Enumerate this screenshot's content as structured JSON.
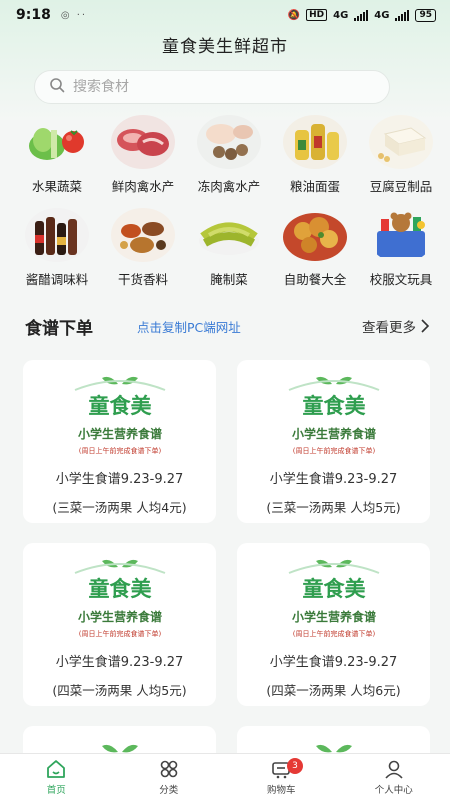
{
  "status_bar": {
    "time": "9:18",
    "left_icons": "◎ ··",
    "hd_label": "HD",
    "net1": "4G",
    "net2": "4G",
    "battery": "95"
  },
  "header": {
    "title": "童食美生鲜超市"
  },
  "search": {
    "placeholder": "搜索食材"
  },
  "categories": [
    {
      "label": "水果蔬菜",
      "icon": "vegetables-image"
    },
    {
      "label": "鲜肉禽水产",
      "icon": "meat-image"
    },
    {
      "label": "冻肉禽水产",
      "icon": "frozen-meat-image"
    },
    {
      "label": "粮油面蛋",
      "icon": "grain-oil-image"
    },
    {
      "label": "豆腐豆制品",
      "icon": "tofu-image"
    },
    {
      "label": "酱醋调味料",
      "icon": "sauce-image"
    },
    {
      "label": "干货香料",
      "icon": "spice-image"
    },
    {
      "label": "腌制菜",
      "icon": "pickle-image"
    },
    {
      "label": "自助餐大全",
      "icon": "buffet-image"
    },
    {
      "label": "校服文玩具",
      "icon": "toys-image"
    }
  ],
  "recipe_section": {
    "title": "食谱下单",
    "copy_link": "点击复制PC端网址",
    "more": "查看更多"
  },
  "recipe_logo": {
    "brand": "童食美",
    "subtitle": "小学生营养食谱",
    "note": "(周日上午前完成食谱下单)"
  },
  "recipes": [
    {
      "title": "小学生食谱9.23-9.27",
      "sub": "(三菜一汤两果 人均4元)"
    },
    {
      "title": "小学生食谱9.23-9.27",
      "sub": "(三菜一汤两果 人均5元)"
    },
    {
      "title": "小学生食谱9.23-9.27",
      "sub": "(四菜一汤两果 人均5元)"
    },
    {
      "title": "小学生食谱9.23-9.27",
      "sub": "(四菜一汤两果 人均6元)"
    }
  ],
  "bottom_nav": [
    {
      "label": "首页",
      "icon": "home-icon",
      "active": true
    },
    {
      "label": "分类",
      "icon": "category-icon",
      "active": false
    },
    {
      "label": "购物车",
      "icon": "cart-icon",
      "active": false,
      "badge": "3"
    },
    {
      "label": "个人中心",
      "icon": "user-icon",
      "active": false
    }
  ],
  "colors": {
    "accent": "#2fa55c",
    "link": "#3a7bd5",
    "badge": "#e53935"
  }
}
